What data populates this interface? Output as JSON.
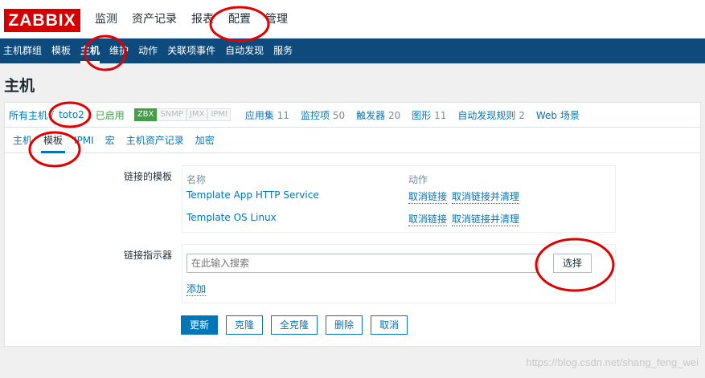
{
  "header": {
    "logo": "ZABBIX",
    "menu": [
      "监测",
      "资产记录",
      "报表",
      "配置",
      "管理"
    ]
  },
  "subnav": {
    "items": [
      "主机群组",
      "模板",
      "主机",
      "维护",
      "动作",
      "关联项事件",
      "自动发现",
      "服务"
    ],
    "active": "主机"
  },
  "page": {
    "title": "主机"
  },
  "hostbar": {
    "all_hosts": "所有主机",
    "sep": "/",
    "host": "toto2",
    "status": "已启用",
    "availability": [
      "ZBX",
      "SNMP",
      "JMX",
      "IPMI"
    ],
    "links": [
      {
        "label": "应用集",
        "count": "11"
      },
      {
        "label": "监控项",
        "count": "50"
      },
      {
        "label": "触发器",
        "count": "20"
      },
      {
        "label": "图形",
        "count": "11"
      },
      {
        "label": "自动发现规则",
        "count": "2"
      },
      {
        "label": "Web 场景",
        "count": ""
      }
    ]
  },
  "tabs": [
    "主机",
    "模板",
    "IPMI",
    "宏",
    "主机资产记录",
    "加密"
  ],
  "linked_templates": {
    "label": "链接的模板",
    "col_name": "名称",
    "col_action": "动作",
    "rows": [
      {
        "name": "Template App HTTP Service",
        "unlink": "取消链接",
        "unlink_clear": "取消链接并清理"
      },
      {
        "name": "Template OS Linux",
        "unlink": "取消链接",
        "unlink_clear": "取消链接并清理"
      }
    ]
  },
  "link_indicator": {
    "label": "链接指示器",
    "placeholder": "在此输入搜索",
    "select": "选择",
    "add": "添加"
  },
  "buttons": {
    "update": "更新",
    "clone": "克隆",
    "full_clone": "全克隆",
    "delete": "删除",
    "cancel": "取消"
  },
  "watermark": "https://blog.csdn.net/shang_feng_wei",
  "colors": {
    "brand": "#d40000",
    "nav": "#0e4b7c",
    "link": "#0275b8",
    "enabled": "#429e47",
    "annotation": "#e00000"
  }
}
